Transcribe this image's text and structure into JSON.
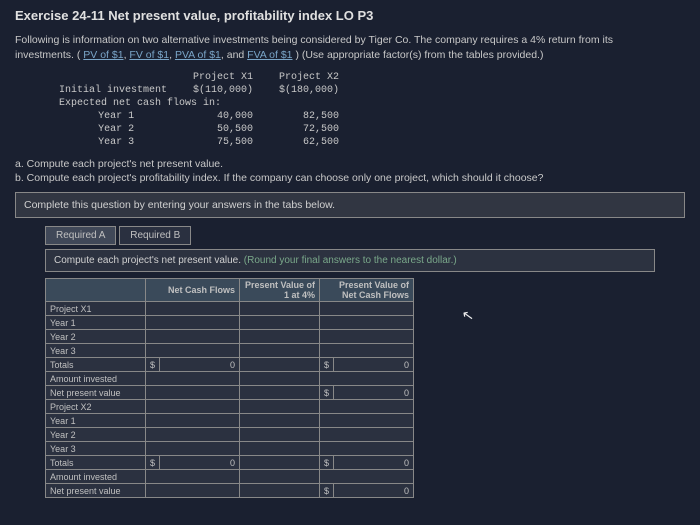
{
  "title": "Exercise 24-11 Net present value, profitability index LO P3",
  "intro": {
    "line1a": "Following is information on two alternative investments being considered by Tiger Co. The company requires a 4% return from its",
    "line2a": "investments. (",
    "link1": "PV of $1",
    "sep": ", ",
    "link2": "FV of $1",
    "link3": "PVA of $1",
    "and": ", and ",
    "link4": "FVA of $1",
    "line2b": ") (Use appropriate factor(s) from the tables provided.)"
  },
  "data_table": {
    "h1": "Project X1",
    "h2": "Project X2",
    "r0": "Initial investment",
    "r0v1": "$(110,000)",
    "r0v2": "$(180,000)",
    "r1": "Expected net cash flows in:",
    "y1": "Year 1",
    "y1v1": "40,000",
    "y1v2": "82,500",
    "y2": "Year 2",
    "y2v1": "50,500",
    "y2v2": "72,500",
    "y3": "Year 3",
    "y3v1": "75,500",
    "y3v2": "62,500"
  },
  "qa": "a. Compute each project's net present value.",
  "qb": "b. Compute each project's profitability index. If the company can choose only one project, which should it choose?",
  "box": "Complete this question by entering your answers in the tabs below.",
  "tabs": {
    "a": "Required A",
    "b": "Required B"
  },
  "subinstr": {
    "plain": "Compute each project's net present value. ",
    "green": "(Round your final answers to the nearest dollar.)"
  },
  "answer": {
    "h1": "Net Cash Flows",
    "h2": "Present Value of 1 at 4%",
    "h3": "Present Value of Net Cash Flows",
    "rows": {
      "px1": "Project X1",
      "y1": "Year 1",
      "y2": "Year 2",
      "y3": "Year 3",
      "totals": "Totals",
      "ai": "Amount invested",
      "npv": "Net present value",
      "px2": "Project X2"
    },
    "zero": "0",
    "dollar": "$"
  }
}
